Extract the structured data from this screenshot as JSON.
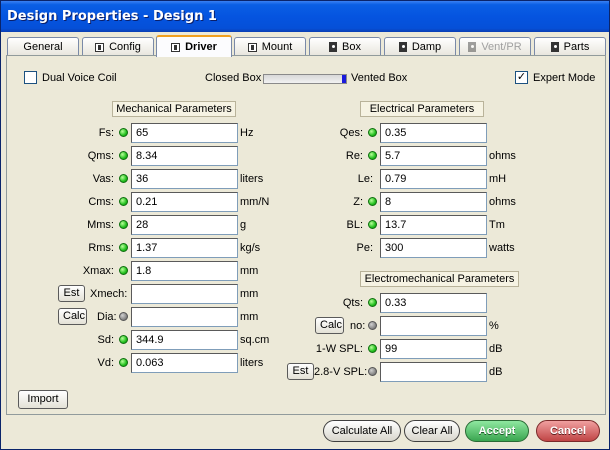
{
  "window": {
    "title": "Design Properties - Design 1"
  },
  "tabs": [
    {
      "label": "General",
      "icon": "none"
    },
    {
      "label": "Config",
      "icon": "speaker-icon"
    },
    {
      "label": "Driver",
      "icon": "speaker-icon",
      "active": true
    },
    {
      "label": "Mount",
      "icon": "speaker-icon"
    },
    {
      "label": "Box",
      "icon": "box-icon"
    },
    {
      "label": "Damp",
      "icon": "box-icon"
    },
    {
      "label": "Vent/PR",
      "icon": "box-icon",
      "disabled": true
    },
    {
      "label": "Parts",
      "icon": "box-icon"
    }
  ],
  "options": {
    "dual_voice_coil": {
      "label": "Dual Voice Coil",
      "checked": false
    },
    "closed_box_label": "Closed Box",
    "vented_box_label": "Vented Box",
    "expert_mode": {
      "label": "Expert Mode",
      "checked": true,
      "mark": "✓"
    }
  },
  "mechanical": {
    "header": "Mechanical Parameters",
    "rows": [
      {
        "label": "Fs:",
        "value": "65",
        "unit": "Hz",
        "led": "green"
      },
      {
        "label": "Qms:",
        "value": "8.34",
        "unit": "",
        "led": "green"
      },
      {
        "label": "Vas:",
        "value": "36",
        "unit": "liters",
        "led": "green"
      },
      {
        "label": "Cms:",
        "value": "0.21",
        "unit": "mm/N",
        "led": "green"
      },
      {
        "label": "Mms:",
        "value": "28",
        "unit": "g",
        "led": "green"
      },
      {
        "label": "Rms:",
        "value": "1.37",
        "unit": "kg/s",
        "led": "green"
      },
      {
        "label": "Xmax:",
        "value": "1.8",
        "unit": "mm",
        "led": "green"
      },
      {
        "label": "Xmech:",
        "value": "",
        "unit": "mm",
        "led": "none",
        "button": "Est"
      },
      {
        "label": "Dia:",
        "value": "",
        "unit": "mm",
        "led": "gray",
        "button": "Calc"
      },
      {
        "label": "Sd:",
        "value": "344.9",
        "unit": "sq.cm",
        "led": "green"
      },
      {
        "label": "Vd:",
        "value": "0.063",
        "unit": "liters",
        "led": "green"
      }
    ]
  },
  "electrical": {
    "header": "Electrical Parameters",
    "rows": [
      {
        "label": "Qes:",
        "value": "0.35",
        "unit": "",
        "led": "green"
      },
      {
        "label": "Re:",
        "value": "5.7",
        "unit": "ohms",
        "led": "green"
      },
      {
        "label": "Le:",
        "value": "0.79",
        "unit": "mH",
        "led": "none"
      },
      {
        "label": "Z:",
        "value": "8",
        "unit": "ohms",
        "led": "green"
      },
      {
        "label": "BL:",
        "value": "13.7",
        "unit": "Tm",
        "led": "green"
      },
      {
        "label": "Pe:",
        "value": "300",
        "unit": "watts",
        "led": "none"
      }
    ]
  },
  "electromechanical": {
    "header": "Electromechanical Parameters",
    "rows": [
      {
        "label": "Qts:",
        "value": "0.33",
        "unit": "",
        "led": "green"
      },
      {
        "label": "no:",
        "value": "",
        "unit": "%",
        "led": "gray",
        "button": "Calc"
      },
      {
        "label": "1-W SPL:",
        "value": "99",
        "unit": "dB",
        "led": "green"
      },
      {
        "label": "2.8-V SPL:",
        "value": "",
        "unit": "dB",
        "led": "gray",
        "button": "Est"
      }
    ]
  },
  "import_button": "Import",
  "footer": {
    "calculate_all": "Calculate All",
    "clear_all": "Clear All",
    "accept": "Accept",
    "cancel": "Cancel"
  }
}
